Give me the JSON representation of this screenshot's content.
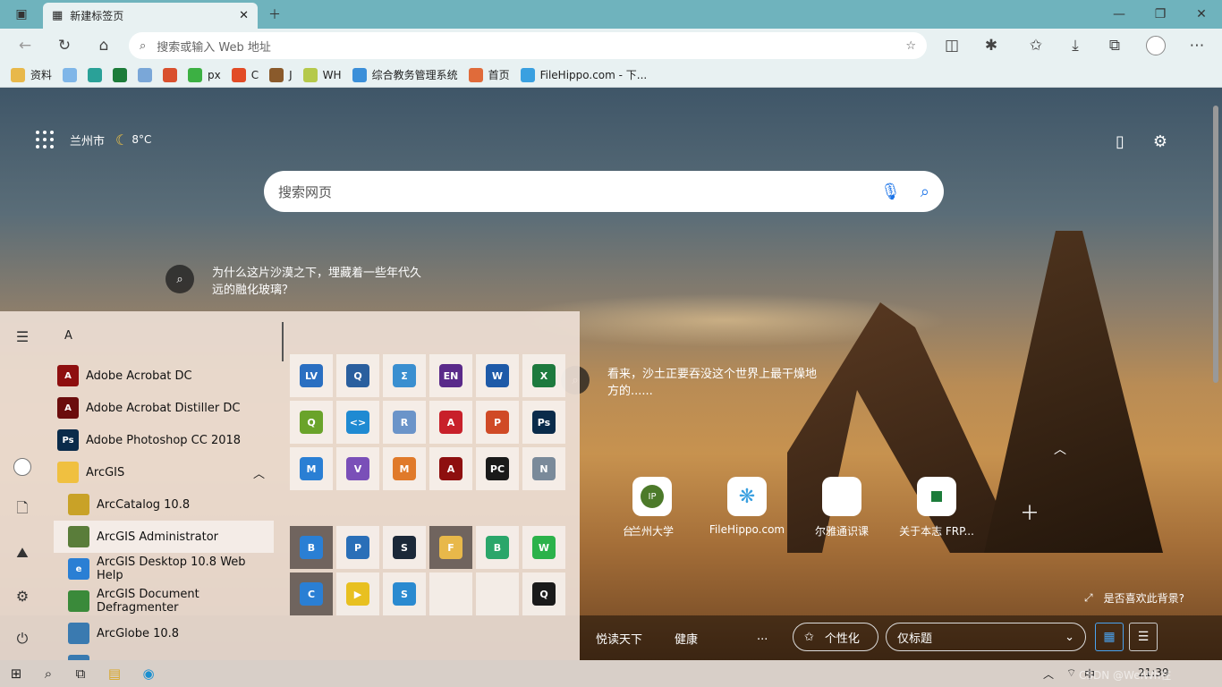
{
  "browser": {
    "tab_title": "新建标签页",
    "omnibox_placeholder": "搜索或输入 Web 地址"
  },
  "favorites": [
    {
      "label": "资料",
      "icon": "folder-icon",
      "color": "#e8b84a"
    },
    {
      "label": "",
      "icon": "snowflake-icon",
      "color": "#7fb6e8"
    },
    {
      "label": "",
      "icon": "book-icon",
      "color": "#2aa198"
    },
    {
      "label": "",
      "icon": "green-doc-icon",
      "color": "#1c7c3a"
    },
    {
      "label": "",
      "icon": "globe-icon",
      "color": "#7aa7d8"
    },
    {
      "label": "",
      "icon": "badge-icon",
      "color": "#d9502e"
    },
    {
      "label": "px",
      "icon": "px-icon",
      "color": "#3cb043"
    },
    {
      "label": "C",
      "icon": "c-icon",
      "color": "#e24b26"
    },
    {
      "label": "J",
      "icon": "j-icon",
      "color": "#8a5a2b"
    },
    {
      "label": "WH",
      "icon": "wh-icon",
      "color": "#b5c94b"
    },
    {
      "label": "综合教务管理系统",
      "icon": "diamond-icon",
      "color": "#3b8fd9"
    },
    {
      "label": "首页",
      "icon": "cube-icon",
      "color": "#e06b3a"
    },
    {
      "label": "FileHippo.com - 下...",
      "icon": "filehippo-icon",
      "color": "#3aa0e0"
    }
  ],
  "newtab": {
    "city": "兰州市",
    "temperature": "8°C",
    "search_placeholder": "搜索网页",
    "fact1": [
      "为什么这片沙漠之下，埋藏着一些年代久",
      "远的融化玻璃？"
    ],
    "fact2": [
      "看来，沙土正要吞没这个世界上最干燥地",
      "方的......"
    ],
    "quicklinks": [
      {
        "label": "台",
        "tile": ""
      },
      {
        "label": "兰州大学",
        "tile": "IP"
      },
      {
        "label": "FileHippo.com",
        "tile": ""
      },
      {
        "label": "尔雅通识课",
        "tile": ""
      },
      {
        "label": "关于本志 FRP...",
        "tile": ""
      }
    ],
    "bg_question": "是否喜欢此背景?",
    "bottom": {
      "item1": "悦读天下",
      "item2": "健康",
      "more": "...",
      "personalize": "个性化",
      "layout_select": "仅标题"
    }
  },
  "startmenu": {
    "letter": "A",
    "apps": [
      {
        "label": "Adobe Acrobat DC",
        "icon": "acrobat-icon",
        "color": "#8e0f0f",
        "text": "A"
      },
      {
        "label": "Adobe Acrobat Distiller DC",
        "icon": "distiller-icon",
        "color": "#6b0d0d",
        "text": "A"
      },
      {
        "label": "Adobe Photoshop CC 2018",
        "icon": "photoshop-icon",
        "color": "#0a2b4a",
        "text": "Ps"
      },
      {
        "label": "ArcGIS",
        "icon": "folder-icon",
        "color": "#f0c040",
        "text": ""
      },
      {
        "label": "ArcCatalog 10.8",
        "icon": "arccatalog-icon",
        "color": "#c9a227",
        "text": ""
      },
      {
        "label": "ArcGIS Administrator",
        "icon": "arcgis-admin-icon",
        "color": "#5a7d3a",
        "text": ""
      },
      {
        "label": "ArcGIS Desktop 10.8 Web Help",
        "icon": "ie-icon",
        "color": "#2a7fd4",
        "text": "e"
      },
      {
        "label": "ArcGIS Document Defragmenter",
        "icon": "defrag-icon",
        "color": "#3a8a3a",
        "text": ""
      },
      {
        "label": "ArcGlobe 10.8",
        "icon": "arcglobe-icon",
        "color": "#3a7ab0",
        "text": ""
      },
      {
        "label": "ArcMap 10.8",
        "icon": "arcmap-icon",
        "color": "#3a7ab0",
        "text": ""
      }
    ],
    "tiles_top": [
      {
        "name": "lv-tile",
        "text": "LV",
        "color": "#2a6fc1"
      },
      {
        "name": "search-tile",
        "text": "Q",
        "color": "#2a5f9e"
      },
      {
        "name": "sigma-tile",
        "text": "Σ",
        "color": "#3a8fd0"
      },
      {
        "name": "en-tile",
        "text": "EN",
        "color": "#5a2a8a"
      },
      {
        "name": "word-tile",
        "text": "W",
        "color": "#1e5aa8"
      },
      {
        "name": "excel-tile",
        "text": "X",
        "color": "#1d7a3e"
      },
      {
        "name": "qgis-tile",
        "text": "Q",
        "color": "#6aa32a"
      },
      {
        "name": "vscode-tile",
        "text": "<>",
        "color": "#1f8ad2"
      },
      {
        "name": "r-tile",
        "text": "R",
        "color": "#6b94c9"
      },
      {
        "name": "autocad-tile",
        "text": "A",
        "color": "#c8202a"
      },
      {
        "name": "powerpoint-tile",
        "text": "P",
        "color": "#d04a26"
      },
      {
        "name": "ps-tile",
        "text": "Ps",
        "color": "#0a2b4a"
      },
      {
        "name": "edu-tile",
        "text": "M",
        "color": "#2a7fd4"
      },
      {
        "name": "vs-tile",
        "text": "V",
        "color": "#7a4fb8"
      },
      {
        "name": "matlab-tile",
        "text": "M",
        "color": "#e07a2a"
      },
      {
        "name": "acrobat-tile",
        "text": "A",
        "color": "#8e0f0f"
      },
      {
        "name": "pycharm-tile",
        "text": "PC",
        "color": "#1a1a1a"
      },
      {
        "name": "network-tile",
        "text": "N",
        "color": "#7a8a9a"
      }
    ],
    "tiles_bottom": [
      {
        "name": "baidu-tile",
        "text": "B",
        "color": "#2a7fd4"
      },
      {
        "name": "photos-tile",
        "text": "P",
        "color": "#2a6fb8"
      },
      {
        "name": "steam-tile",
        "text": "S",
        "color": "#1b2838"
      },
      {
        "name": "folder-tile",
        "text": "F",
        "color": "#e8b84a"
      },
      {
        "name": "bird-tile",
        "text": "B",
        "color": "#2aa66a"
      },
      {
        "name": "wechat-tile",
        "text": "W",
        "color": "#2bb24a"
      },
      {
        "name": "cloud-tile",
        "text": "C",
        "color": "#2a7fd4"
      },
      {
        "name": "player-tile",
        "text": "▶",
        "color": "#e8c020"
      },
      {
        "name": "settings-tile",
        "text": "S",
        "color": "#2a8ad0"
      },
      {
        "name": "empty-tile-1",
        "text": "",
        "color": ""
      },
      {
        "name": "empty-tile-2",
        "text": "",
        "color": ""
      },
      {
        "name": "qq-tile",
        "text": "Q",
        "color": "#1a1a1a"
      }
    ]
  },
  "taskbar": {
    "ime": "中",
    "time": "21:39",
    "watermark": "CSDN @WeiWh在"
  }
}
